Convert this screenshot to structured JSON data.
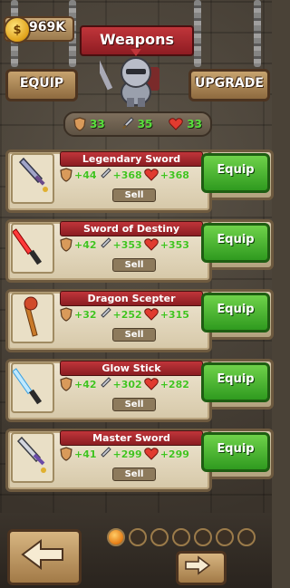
{
  "header": {
    "coins": "969K",
    "coin_symbol": "$",
    "title": "Weapons",
    "equip_tab": "EQUIP",
    "upgrade_tab": "UPGRADE"
  },
  "totals": {
    "shield": "33",
    "attack": "35",
    "health": "33"
  },
  "weapons": [
    {
      "name": "Legendary Sword",
      "shield": "+44",
      "attack": "+368",
      "health": "+368",
      "sell": "Sell",
      "equip": "Equip",
      "icon": "legendary-sword-icon"
    },
    {
      "name": "Sword of Destiny",
      "shield": "+42",
      "attack": "+353",
      "health": "+353",
      "sell": "Sell",
      "equip": "Equip",
      "icon": "red-lightsaber-icon"
    },
    {
      "name": "Dragon Scepter",
      "shield": "+32",
      "attack": "+252",
      "health": "+315",
      "sell": "Sell",
      "equip": "Equip",
      "icon": "dragon-scepter-icon"
    },
    {
      "name": "Glow Stick",
      "shield": "+42",
      "attack": "+302",
      "health": "+282",
      "sell": "Sell",
      "equip": "Equip",
      "icon": "blue-lightsaber-icon"
    },
    {
      "name": "Master Sword",
      "shield": "+41",
      "attack": "+299",
      "health": "+299",
      "sell": "Sell",
      "equip": "Equip",
      "icon": "master-sword-icon"
    }
  ],
  "pagination": {
    "pages": 7,
    "active_page": 1
  },
  "colors": {
    "green_stat": "#59e03d",
    "equip_green": "#3aa82a",
    "banner_red": "#b22a30"
  }
}
